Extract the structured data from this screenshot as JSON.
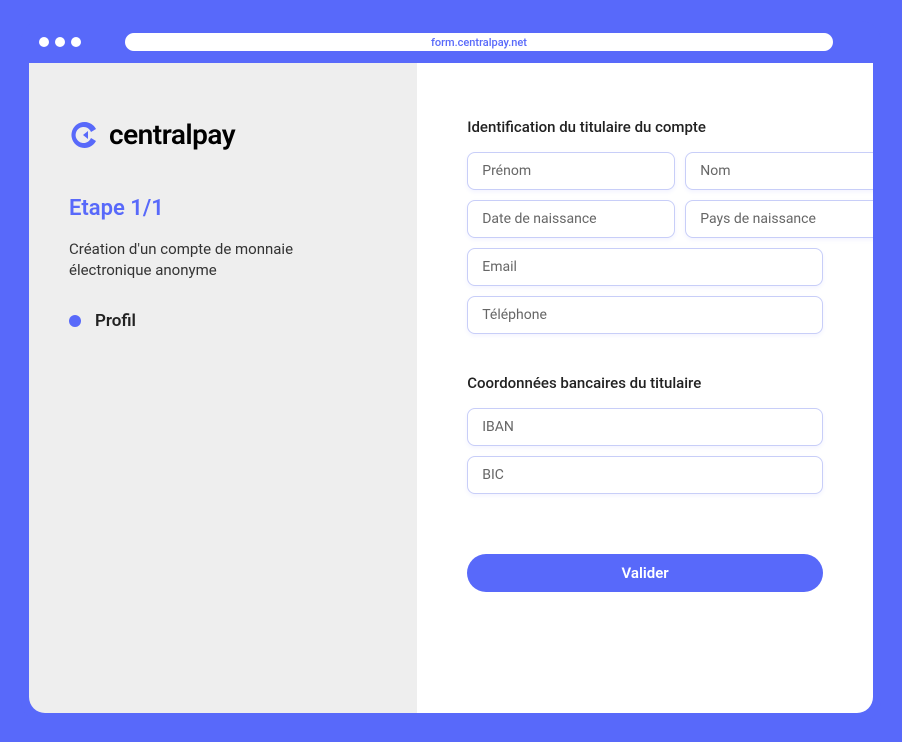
{
  "browser": {
    "url": "form.centralpay.net"
  },
  "logo": {
    "text": "centralpay"
  },
  "sidebar": {
    "step_title": "Etape 1/1",
    "description": "Création d'un compte de monnaie électronique anonyme",
    "step_label": "Profil"
  },
  "form": {
    "identification": {
      "title": "Identification du titulaire du compte",
      "fields": {
        "firstname": "Prénom",
        "lastname": "Nom",
        "birthdate": "Date de naissance",
        "birthcountry": "Pays de naissance",
        "email": "Email",
        "phone": "Téléphone"
      }
    },
    "banking": {
      "title": "Coordonnées bancaires du titulaire",
      "fields": {
        "iban": "IBAN",
        "bic": "BIC"
      }
    },
    "submit_label": "Valider"
  },
  "colors": {
    "primary": "#5869fa"
  }
}
